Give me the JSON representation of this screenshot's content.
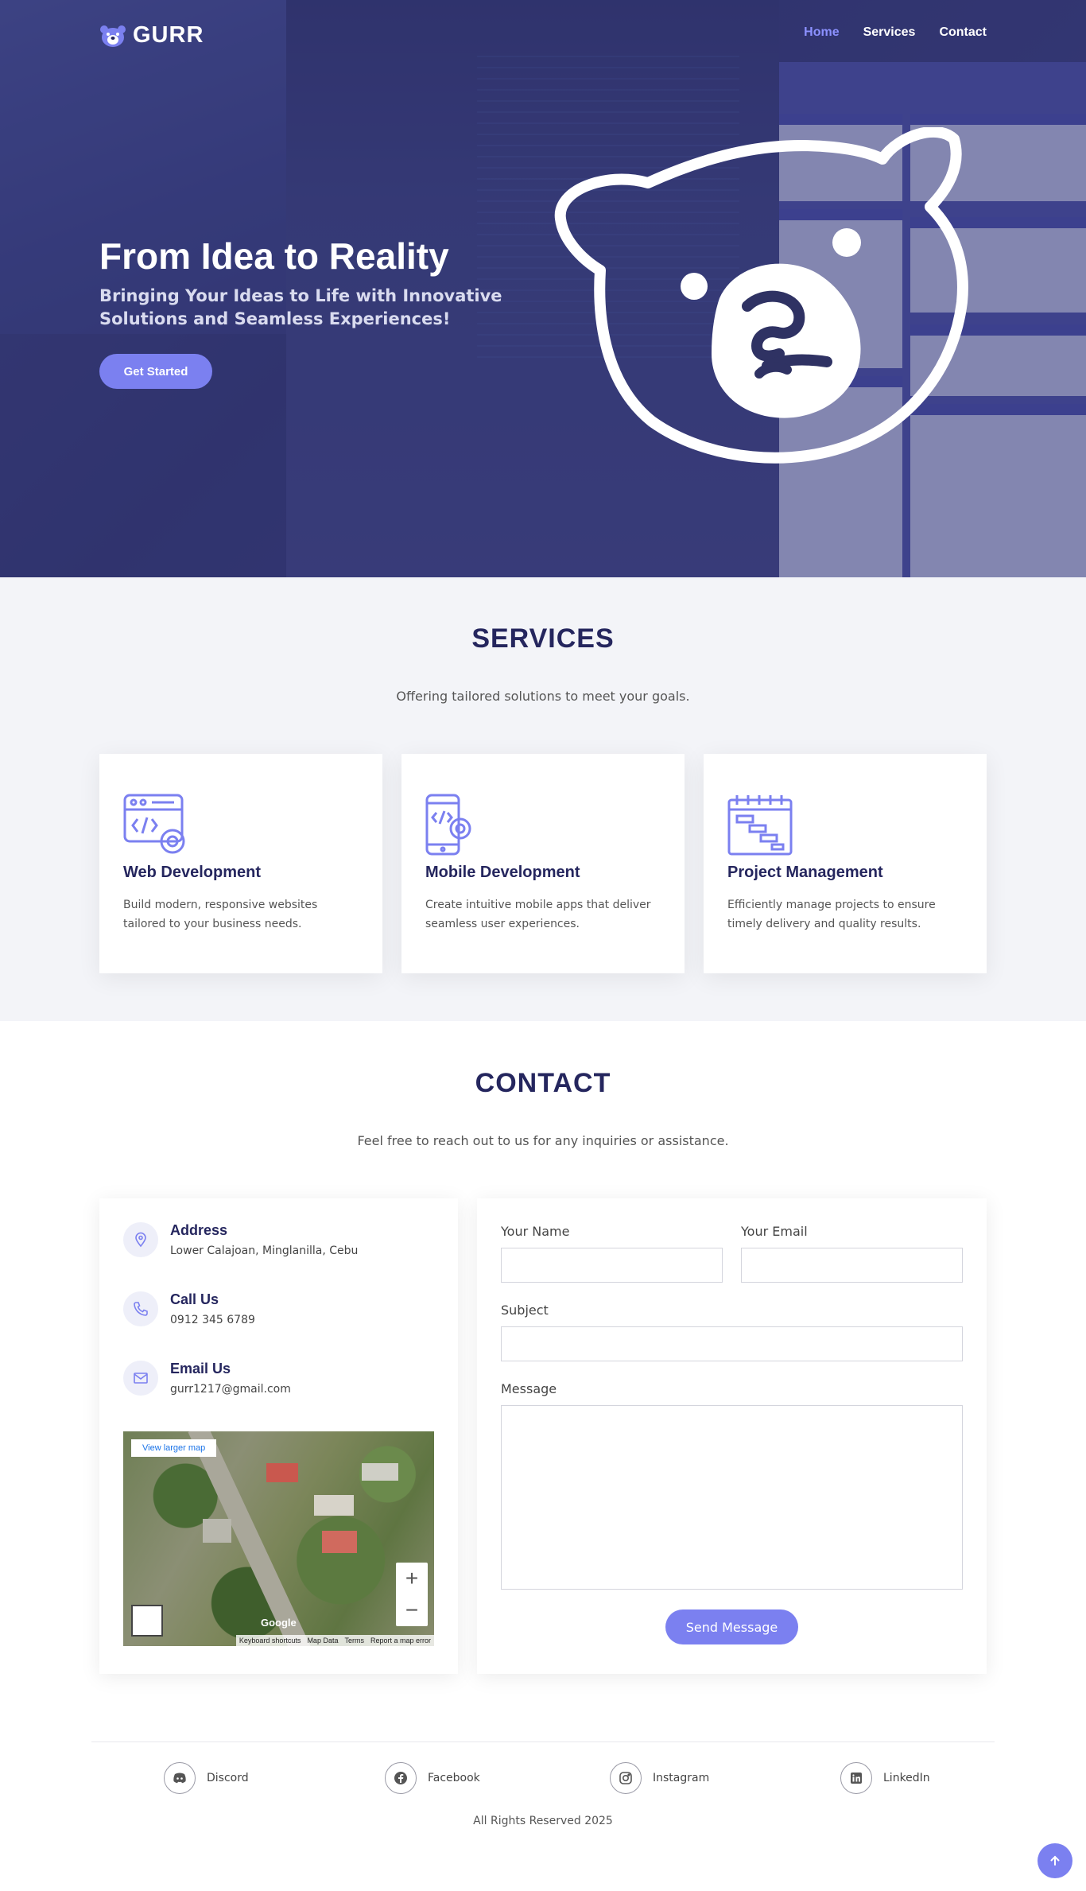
{
  "brand": {
    "name": "GURR",
    "accent": "#7b80f0",
    "dark": "#25265e"
  },
  "nav": {
    "items": [
      {
        "label": "Home",
        "active": true
      },
      {
        "label": "Services"
      },
      {
        "label": "Contact"
      }
    ]
  },
  "hero": {
    "title": "From Idea to Reality",
    "subtitle": "Bringing Your Ideas to Life with Innovative Solutions and Seamless Experiences!",
    "cta": "Get Started"
  },
  "services": {
    "title": "SERVICES",
    "description": "Offering tailored solutions to meet your goals.",
    "cards": [
      {
        "icon": "web-development-icon",
        "title": "Web Development",
        "text": "Build modern, responsive websites tailored to your business needs."
      },
      {
        "icon": "mobile-development-icon",
        "title": "Mobile Development",
        "text": "Create intuitive mobile apps that deliver seamless user experiences."
      },
      {
        "icon": "project-management-icon",
        "title": "Project Management",
        "text": "Efficiently manage projects to ensure timely delivery and quality results."
      }
    ]
  },
  "contact": {
    "title": "CONTACT",
    "description": "Feel free to reach out to us for any inquiries or assistance.",
    "info": [
      {
        "icon": "location-pin-icon",
        "title": "Address",
        "value": "Lower Calajoan, Minglanilla, Cebu"
      },
      {
        "icon": "phone-icon",
        "title": "Call Us",
        "value": "0912 345 6789"
      },
      {
        "icon": "email-icon",
        "title": "Email Us",
        "value": "gurr1217@gmail.com"
      }
    ],
    "map": {
      "link": "View larger map",
      "zoom_in": "+",
      "zoom_out": "−",
      "brand": "Google",
      "footer": [
        "Keyboard shortcuts",
        "Map Data",
        "Terms",
        "Report a map error"
      ]
    },
    "form": {
      "name_label": "Your Name",
      "email_label": "Your Email",
      "subject_label": "Subject",
      "message_label": "Message",
      "name_value": "",
      "email_value": "",
      "subject_value": "",
      "message_value": "",
      "submit": "Send Message"
    }
  },
  "footer": {
    "socials": [
      {
        "icon": "discord-icon",
        "label": "Discord"
      },
      {
        "icon": "facebook-icon",
        "label": "Facebook"
      },
      {
        "icon": "instagram-icon",
        "label": "Instagram"
      },
      {
        "icon": "linkedin-icon",
        "label": "LinkedIn"
      }
    ],
    "copyright": "All Rights Reserved 2025",
    "back_to_top_icon": "arrow-up-icon"
  }
}
